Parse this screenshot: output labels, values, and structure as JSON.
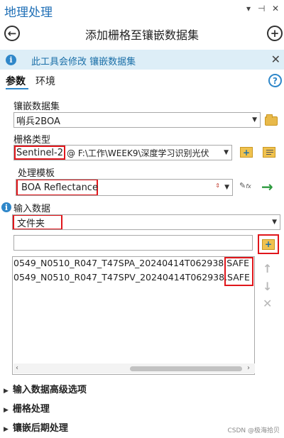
{
  "pane": {
    "title": "地理处理",
    "header_controls": [
      "▾",
      "⊣",
      "✕"
    ]
  },
  "tool": {
    "title": "添加栅格至镶嵌数据集",
    "back_icon": "back-arrow-icon",
    "add_icon": "plus-circle-icon"
  },
  "info_bar": {
    "text": "此工具会修改 镶嵌数据集",
    "icon": "i",
    "close": "✕"
  },
  "tabs": [
    {
      "label": "参数",
      "active": true
    },
    {
      "label": "环境",
      "active": false
    }
  ],
  "help_label": "?",
  "params": {
    "mosaic_label": "镶嵌数据集",
    "mosaic_value": "哨兵2BOA",
    "raster_type_label": "栅格类型",
    "raster_type_value": "Sentinel-2",
    "raster_type_config": "@ F:\\工作\\WEEK9\\深度学习识别光伏",
    "template_label": "处理模板",
    "template_value": "BOA Reflectance",
    "input_label": "输入数据",
    "input_value": "文件夹",
    "path_placeholder": "",
    "files": [
      {
        "name": "0549_N0510_R047_T47SPA_20240414T062938",
        "ext": ".SAFE"
      },
      {
        "name": "0549_N0510_R047_T47SPV_20240414T062938",
        "ext": ".SAFE"
      }
    ]
  },
  "sections": [
    "输入数据高级选项",
    "栅格处理",
    "镶嵌后期处理"
  ],
  "watermark": "CSDN @极海拾贝",
  "colors": {
    "accent": "#2f87c9",
    "highlight_box": "#e0161b",
    "info_bg": "#ddeef7",
    "run_arrow": "#2e9b3f"
  }
}
